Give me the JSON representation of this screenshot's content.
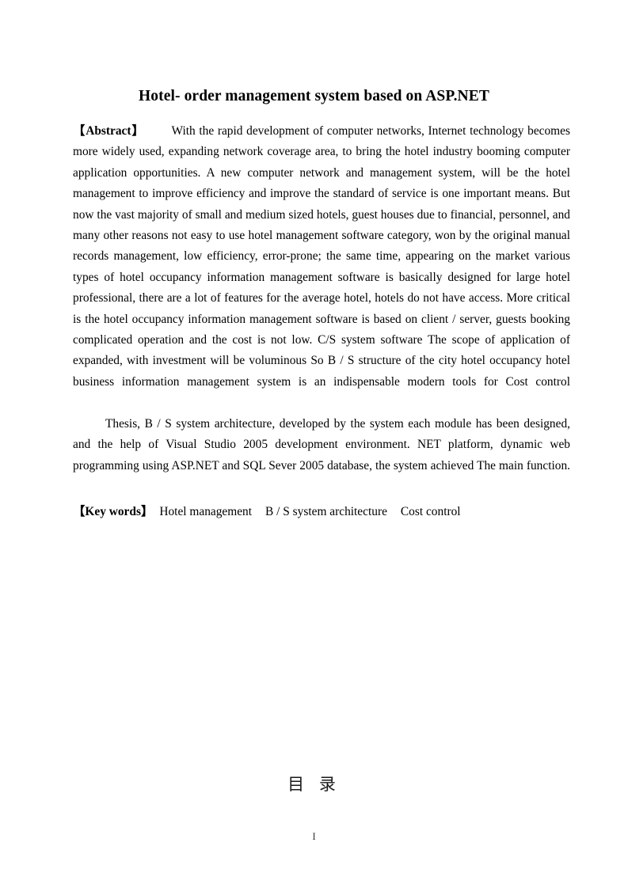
{
  "document": {
    "title": "Hotel- order management system based on ASP.NET",
    "page_number": "I"
  },
  "abstract": {
    "label_open_bracket": "【",
    "label_text": "Abstract",
    "label_close_bracket": "】",
    "paragraph_1": "With the rapid development of computer networks, Internet technology becomes more widely used, expanding network coverage area, to bring the hotel industry booming computer application opportunities. A new computer network and management system, will be the hotel management to improve efficiency and improve the standard of service is one important means. But now the vast majority of small and medium sized hotels, guest houses due to financial, personnel, and many other reasons not easy to use hotel management software category, won by the original manual records management, low efficiency, error-prone; the same time, appearing on the market various types of hotel occupancy information management software is basically designed for large hotel professional, there are a lot of features for the average hotel, hotels do not have access. More critical is the hotel occupancy information management software is based on client / server, guests booking complicated operation and the cost is not low. C/S system software The scope of application of expanded, with investment will be voluminous So B / S structure of the city hotel occupancy hotel business information management system is an indispensable modern tools for Cost control",
    "paragraph_2": "Thesis, B / S system architecture, developed by the system each module has been designed, and the help of Visual Studio 2005 development environment. NET platform, dynamic web programming using ASP.NET and SQL Sever 2005 database, the system achieved The main function."
  },
  "keywords": {
    "label_open_bracket": "【",
    "label_text": "Key words",
    "label_close_bracket": "】",
    "items": [
      "Hotel management",
      "B / S system architecture",
      "Cost control"
    ]
  },
  "toc": {
    "heading": "目 录"
  }
}
